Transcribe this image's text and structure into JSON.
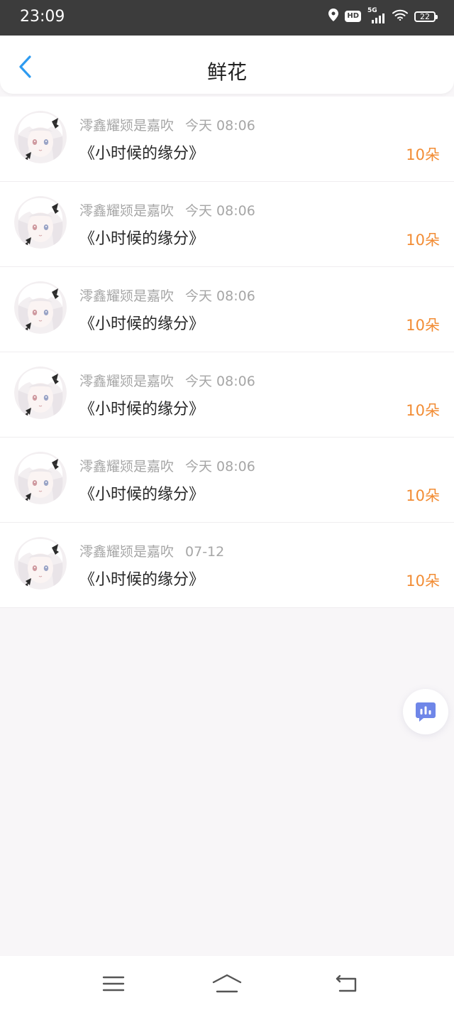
{
  "status_bar": {
    "time": "23:09",
    "network": "5G",
    "hd": "HD",
    "battery": "22",
    "icons": [
      "location-icon",
      "hd-icon",
      "signal-icon",
      "wifi-icon",
      "battery-icon"
    ]
  },
  "header": {
    "title": "鲜花",
    "back_icon": "chevron-left-icon",
    "accent_color": "#2e9bf0"
  },
  "records": [
    {
      "sender": "澪鑫耀颎是嘉吹",
      "time": "今天  08:06",
      "gift": "《小时候的缘分》",
      "count": "10朵"
    },
    {
      "sender": "澪鑫耀颎是嘉吹",
      "time": "今天  08:06",
      "gift": "《小时候的缘分》",
      "count": "10朵"
    },
    {
      "sender": "澪鑫耀颎是嘉吹",
      "time": "今天  08:06",
      "gift": "《小时候的缘分》",
      "count": "10朵"
    },
    {
      "sender": "澪鑫耀颎是嘉吹",
      "time": "今天  08:06",
      "gift": "《小时候的缘分》",
      "count": "10朵"
    },
    {
      "sender": "澪鑫耀颎是嘉吹",
      "time": "今天  08:06",
      "gift": "《小时候的缘分》",
      "count": "10朵"
    },
    {
      "sender": "澪鑫耀颎是嘉吹",
      "time": "07-12",
      "gift": "《小时候的缘分》",
      "count": "10朵"
    }
  ],
  "count_color": "#f28c34",
  "floating_button": {
    "icon": "chat-stats-icon",
    "color": "#6f86e8"
  },
  "bottom_nav": {
    "icons": [
      "menu-icon",
      "home-icon",
      "back-icon"
    ]
  }
}
